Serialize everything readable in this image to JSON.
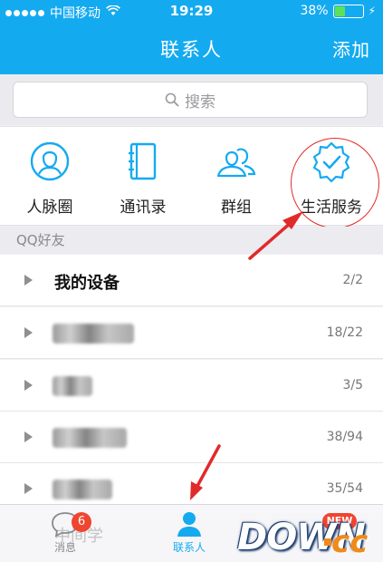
{
  "status_bar": {
    "carrier": "中国移动",
    "time": "19:29",
    "battery_percent": "38%",
    "battery_level": 0.38
  },
  "nav": {
    "title": "联系人",
    "add_label": "添加"
  },
  "search": {
    "placeholder": "搜索"
  },
  "quick_entries": [
    {
      "label": "人脉圈",
      "icon": "person-circle-icon"
    },
    {
      "label": "通讯录",
      "icon": "address-book-icon"
    },
    {
      "label": "群组",
      "icon": "group-icon"
    },
    {
      "label": "生活服务",
      "icon": "verified-badge-icon"
    }
  ],
  "section_header": "QQ好友",
  "groups": [
    {
      "name": "我的设备",
      "count": "2/2"
    },
    {
      "name": "",
      "count": "18/22"
    },
    {
      "name": "",
      "count": "3/5"
    },
    {
      "name": "",
      "count": "38/94"
    },
    {
      "name": "",
      "count": "35/54"
    }
  ],
  "partial_row_text": "中间学",
  "tabs": [
    {
      "label": "消息",
      "badge": "6"
    },
    {
      "label": "联系人"
    },
    {
      "label": "",
      "badge": "NEW"
    }
  ],
  "watermark": {
    "main": "DOWN",
    "suffix": "cc"
  },
  "colors": {
    "brand_blue": "#14aaf0",
    "badge_red": "#f04530",
    "annotation_red": "#e12a2a"
  }
}
